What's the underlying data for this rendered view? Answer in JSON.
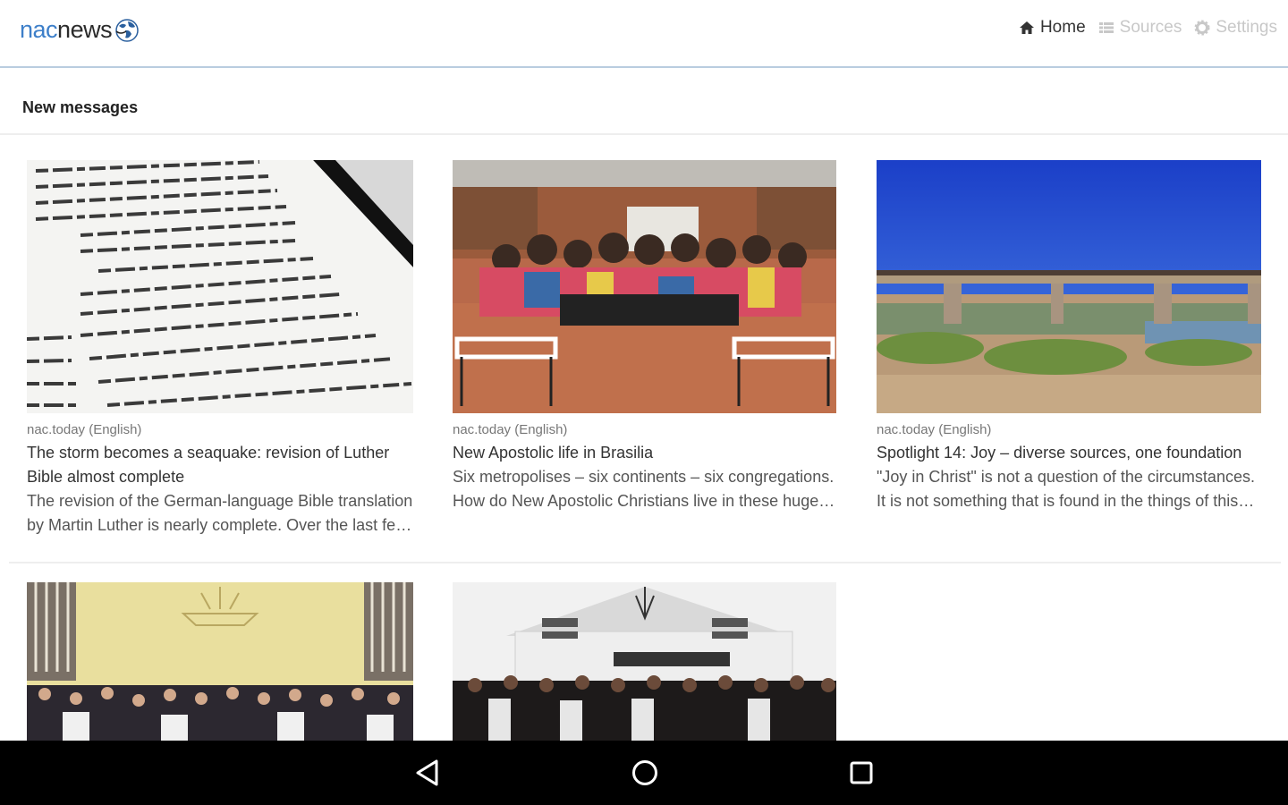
{
  "app": {
    "logo_prefix": "nac",
    "logo_suffix": "news"
  },
  "nav": {
    "home": "Home",
    "sources": "Sources",
    "settings": "Settings",
    "active_color": "#333333",
    "inactive_color": "#c8c8c8"
  },
  "section": {
    "title": "New messages"
  },
  "cards": [
    {
      "source": "nac.today (English)",
      "title": "The storm becomes a seaquake: revision of Luther Bible almost complete",
      "description": "The revision of the German-language Bible translation by Martin Luther is nearly complete. Over the last few years, experts have been working on it."
    },
    {
      "source": "nac.today (English)",
      "title": "New Apostolic life in Brasilia",
      "description": "Six metropolises – six continents – six congregations. How do New Apostolic Christians live in these huge cities? Today we will take a trip to Brasilia."
    },
    {
      "source": "nac.today (English)",
      "title": "Spotlight 14: Joy – diverse sources, one foundation",
      "description": "\"Joy in Christ\" is not a question of the circumstances. It is not something that is found in the things of this world."
    },
    {
      "source": "",
      "title": "",
      "description": ""
    },
    {
      "source": "",
      "title": "",
      "description": ""
    }
  ],
  "colors": {
    "accent": "#3d7fc9",
    "header_border": "#b9cde0"
  },
  "icons": {
    "home": "home-icon",
    "sources": "list-icon",
    "settings": "gear-icon",
    "back": "back-triangle-icon",
    "home_nav": "home-circle-icon",
    "recents": "recents-square-icon"
  }
}
